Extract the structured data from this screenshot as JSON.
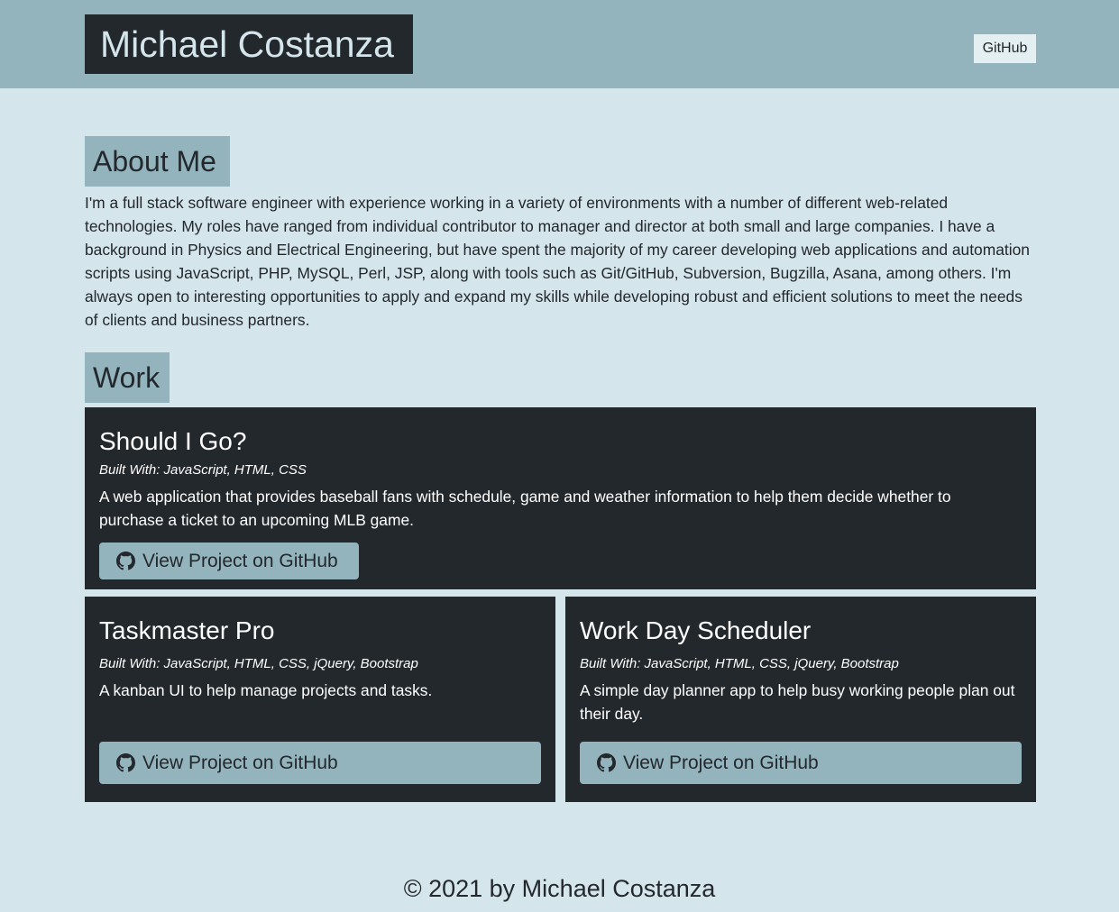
{
  "header": {
    "name": "Michael Costanza",
    "nav_github": "GitHub"
  },
  "about": {
    "heading": "About Me",
    "text": "I'm a full stack software engineer with experience working in a variety of environments with a number of different web-related technologies. My roles have ranged from individual contributor to manager and director at both small and large companies. I have a background in Physics and Electrical Engineering, but have spent the majority of my career developing web applications and automation scripts using JavaScript, PHP, MySQL, Perl, JSP, along with tools such as Git/GitHub, Subversion, Bugzilla, Asana, among others. I'm always open to interesting opportunities to apply and expand my skills while developing robust and efficient solutions to meet the needs of clients and business partners."
  },
  "work": {
    "heading": "Work",
    "projects": [
      {
        "title": "Should I Go?",
        "built_with": "Built With: JavaScript, HTML, CSS",
        "description": "A web application that provides baseball fans with schedule, game and weather information to help them decide whether to purchase a ticket to an upcoming MLB game.",
        "button_label": "View Project on GitHub",
        "button_icon": "github-icon"
      },
      {
        "title": "Taskmaster Pro",
        "built_with": "Built With: JavaScript, HTML, CSS, jQuery, Bootstrap",
        "description": "A kanban UI to help manage projects and tasks.",
        "button_label": "View Project on GitHub",
        "button_icon": "github-icon"
      },
      {
        "title": "Work Day Scheduler",
        "built_with": "Built With: JavaScript, HTML, CSS, jQuery, Bootstrap",
        "description": "A simple day planner app to help busy working people plan out their day.",
        "button_label": "View Project on GitHub",
        "button_icon": "github-icon"
      }
    ]
  },
  "footer": {
    "text": "© 2021 by Michael Costanza"
  },
  "colors": {
    "page_background": "#d4e5eb",
    "accent": "#93b3bd",
    "dark": "#23282d"
  }
}
